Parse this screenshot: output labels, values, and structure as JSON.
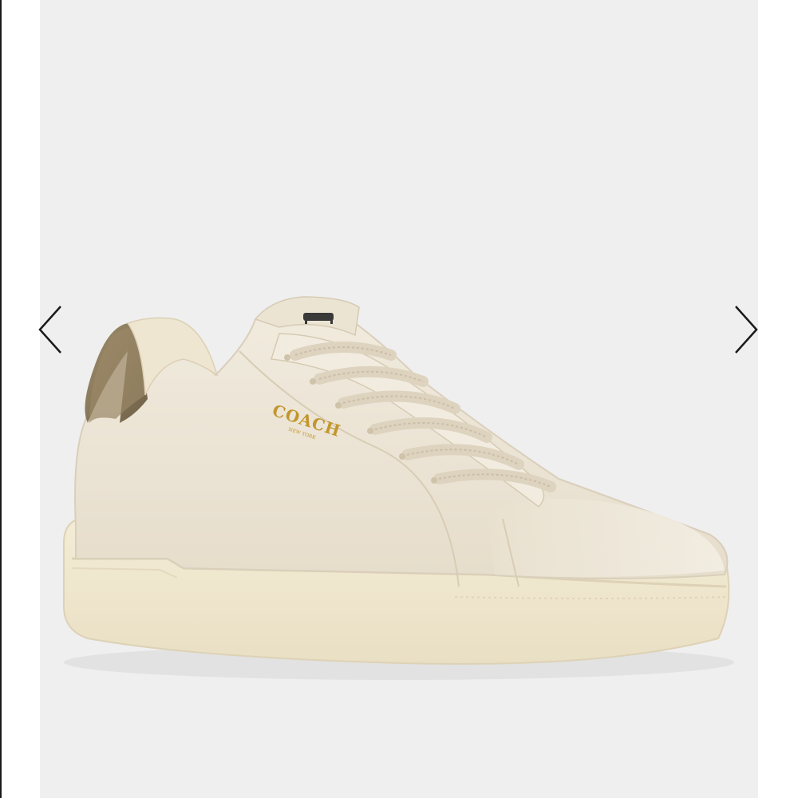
{
  "carousel": {
    "image_subject": "sneaker-photo",
    "prev_icon": "chevron-left-icon",
    "next_icon": "chevron-right-icon"
  },
  "product": {
    "brand_mark": "COACH",
    "brand_sub": "NEW YORK"
  },
  "colors": {
    "frame_background": "#efefef",
    "shoe_leather": "#ece5d6",
    "sole": "#f2ead4",
    "heel_tab": "#8a7a5c",
    "logo_gold": "#c2962e",
    "arrow": "#1a1a1a"
  }
}
